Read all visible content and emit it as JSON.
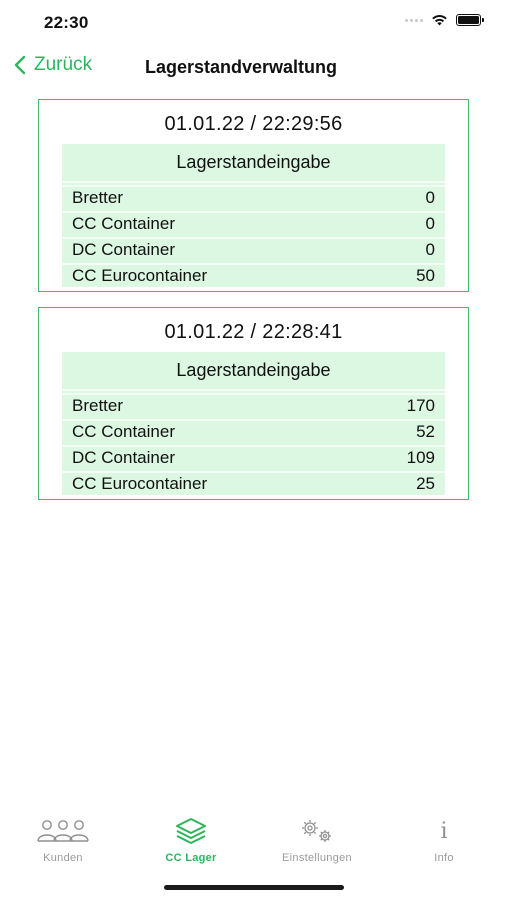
{
  "status_bar": {
    "time": "22:30"
  },
  "nav": {
    "back_label": "Zurück",
    "title": "Lagerstandverwaltung"
  },
  "entries": [
    {
      "datetime": "01.01.22 / 22:29:56",
      "header": "Lagerstandeingabe",
      "rows": [
        {
          "label": "Bretter",
          "value": "0"
        },
        {
          "label": "CC Container",
          "value": "0"
        },
        {
          "label": "DC Container",
          "value": "0"
        },
        {
          "label": "CC Eurocontainer",
          "value": "50"
        }
      ]
    },
    {
      "datetime": "01.01.22 / 22:28:41",
      "header": "Lagerstandeingabe",
      "rows": [
        {
          "label": "Bretter",
          "value": "170"
        },
        {
          "label": "CC Container",
          "value": "52"
        },
        {
          "label": "DC Container",
          "value": "109"
        },
        {
          "label": "CC Eurocontainer",
          "value": "25"
        }
      ]
    }
  ],
  "tabs": [
    {
      "label": "Kunden",
      "icon": "people-icon",
      "active": false
    },
    {
      "label": "CC Lager",
      "icon": "layers-icon",
      "active": true
    },
    {
      "label": "Einstellungen",
      "icon": "gears-icon",
      "active": false
    },
    {
      "label": "Info",
      "icon": "info-icon",
      "active": false
    }
  ],
  "colors": {
    "accent": "#2db55d",
    "card_border": "#49b46a",
    "table_bg": "#dcf7e2",
    "inactive_tab": "#9a9a9a"
  }
}
